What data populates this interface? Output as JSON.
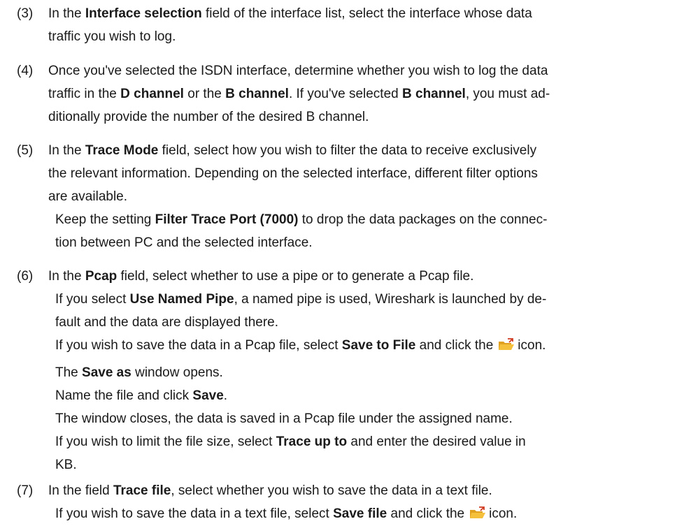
{
  "steps": [
    {
      "number": "(3)",
      "lines": [
        {
          "t1": "In the ",
          "b1": "Interface selection",
          "t2": " field of the interface list, select the interface whose data"
        },
        {
          "t1": "traffic you wish to log."
        }
      ]
    },
    {
      "number": "(4)",
      "lines": [
        {
          "t1": "Once you've selected the ISDN interface, determine whether you wish to log the data"
        },
        {
          "t1": "traffic in the ",
          "b1": "D channel",
          "t2": " or the ",
          "b2": "B channel",
          "t3": ". If you've selected ",
          "b3": "B channel",
          "t4": ", you must ad-"
        },
        {
          "t1": "ditionally provide the number of the desired B channel."
        }
      ]
    },
    {
      "number": "(5)",
      "lines": [
        {
          "t1": "In the ",
          "b1": "Trace Mode",
          "t2": " field, select how you wish to filter the data to receive exclusively"
        },
        {
          "t1": "the relevant information. Depending on the selected interface, different filter options"
        },
        {
          "t1": "are available."
        }
      ],
      "sub": [
        {
          "t1": "Keep the setting ",
          "b1": "Filter Trace Port (7000)",
          "t2": " to drop the data packages on the connec-"
        },
        {
          "t1": "tion between PC and the selected interface."
        }
      ]
    },
    {
      "number": "(6)",
      "lines": [
        {
          "t1": "In the ",
          "b1": "Pcap",
          "t2": " field, select whether to use a pipe or to generate a Pcap file."
        }
      ],
      "sub": [
        {
          "t1": "If you select ",
          "b1": "Use Named Pipe",
          "t2": ", a named pipe is used, Wireshark is launched by de-"
        },
        {
          "t1": "fault and the data are displayed there."
        },
        {
          "t1": "If you wish to save the data in a Pcap file, select ",
          "b1": "Save to File",
          "t2": " and click the",
          "icon": "folder-open-icon",
          "t3": "icon."
        },
        {
          "t1": "The ",
          "b1": "Save as",
          "t2": " window opens."
        },
        {
          "t1": "Name the file and click ",
          "b1": "Save",
          "t2": "."
        },
        {
          "t1": "The window closes, the data is saved in a Pcap file under the assigned name."
        },
        {
          "t1": "If you wish to limit the file size, select ",
          "b1": "Trace up to",
          "t2": " and enter the desired value in"
        },
        {
          "t1": "KB."
        }
      ]
    },
    {
      "number": "(7)",
      "lines": [
        {
          "t1": "In the field ",
          "b1": "Trace file",
          "t2": ", select whether you wish to save the data in a text file."
        }
      ],
      "sub": [
        {
          "t1": "If you wish to save the data in a text file, select ",
          "b1": "Save file",
          "t2": " and click the",
          "icon": "folder-open-icon",
          "t3": "icon."
        }
      ]
    }
  ],
  "colors": {
    "text": "#1a1a1a",
    "folder_front": "#f5c03c",
    "folder_back": "#e0a020",
    "folder_arrow": "#d03a20"
  }
}
